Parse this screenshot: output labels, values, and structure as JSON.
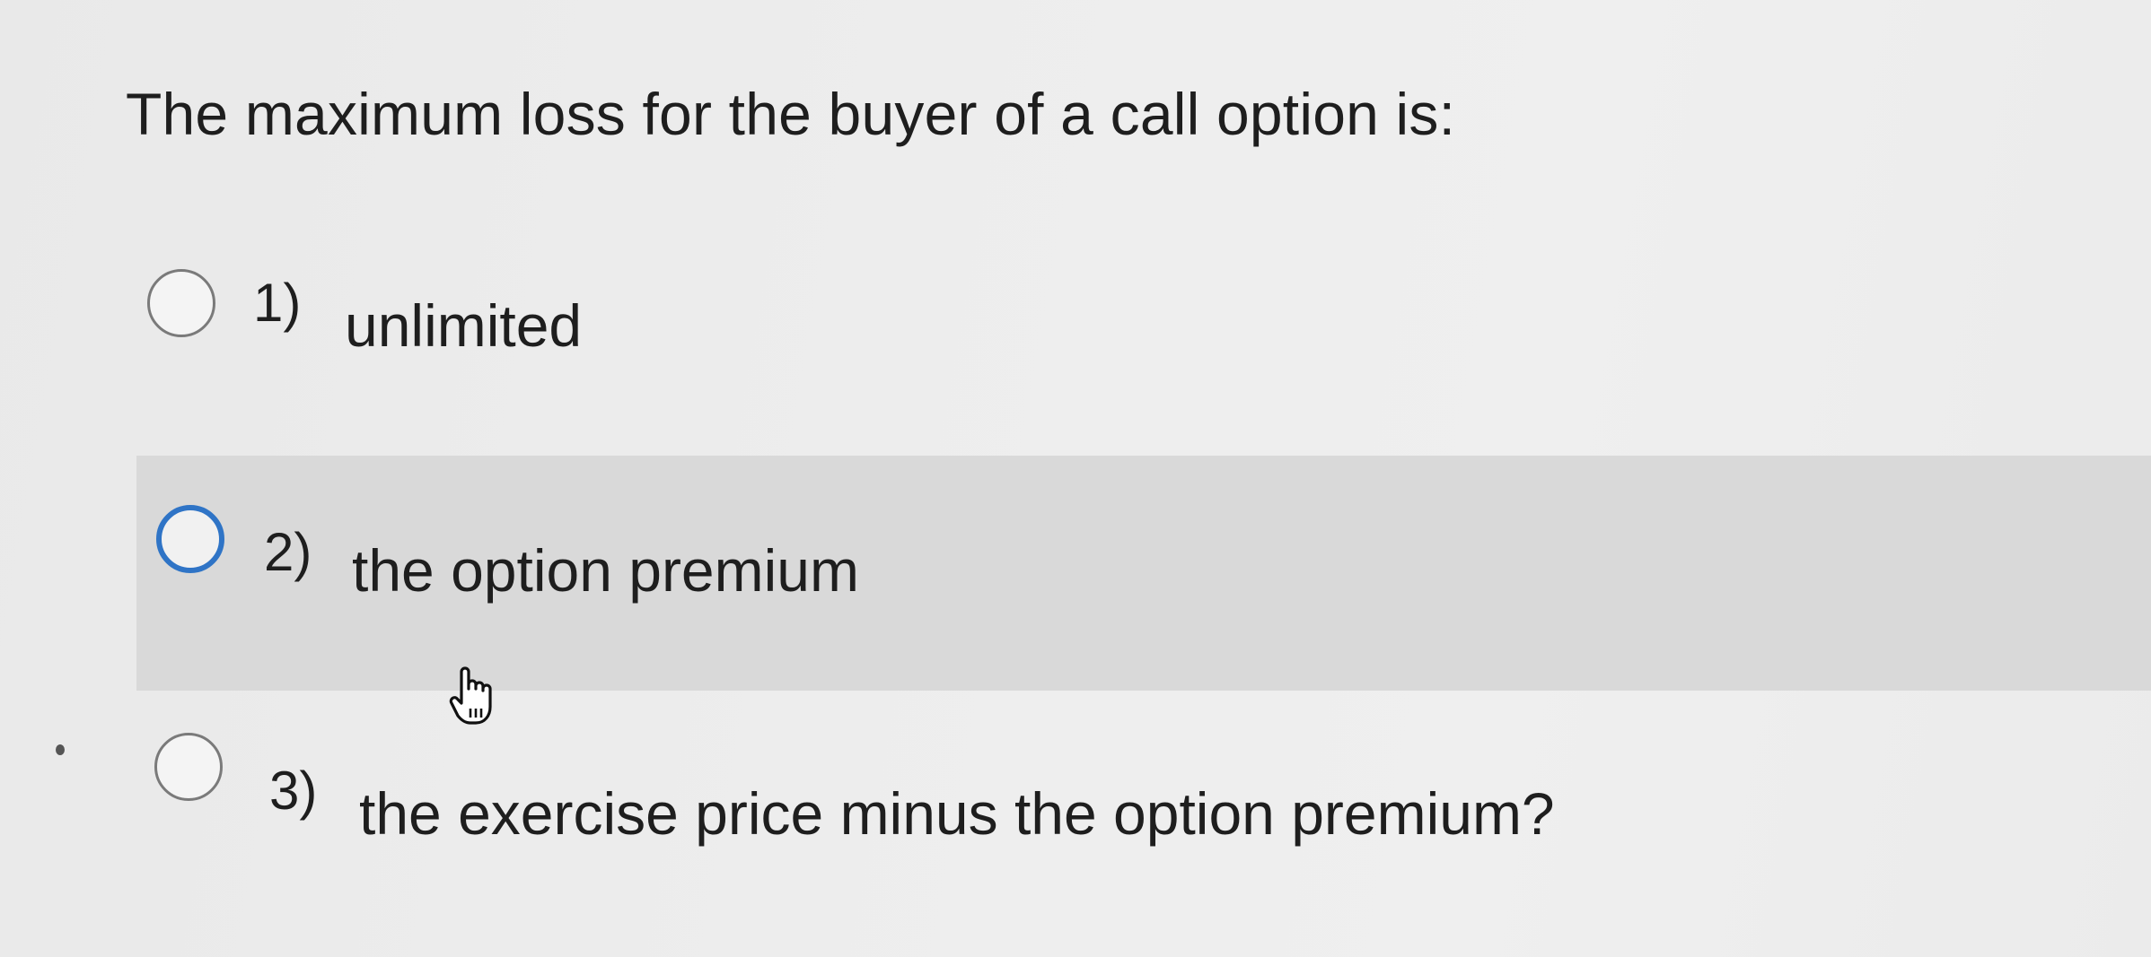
{
  "question": {
    "text": "The maximum loss for the buyer of a call option is:"
  },
  "options": [
    {
      "number": "1)",
      "label": "unlimited",
      "state": "unselected"
    },
    {
      "number": "2)",
      "label": "the option premium",
      "state": "hover-focused"
    },
    {
      "number": "3)",
      "label": "the exercise price minus the option premium?",
      "state": "unselected"
    }
  ],
  "colors": {
    "background": "#ededed",
    "hover_row": "#d9d9d9",
    "focus_ring": "#2f74c6",
    "radio_border": "#7a7a7a",
    "text": "#1e1e1e"
  },
  "icons": {
    "pointer": "hand-pointer-icon"
  }
}
